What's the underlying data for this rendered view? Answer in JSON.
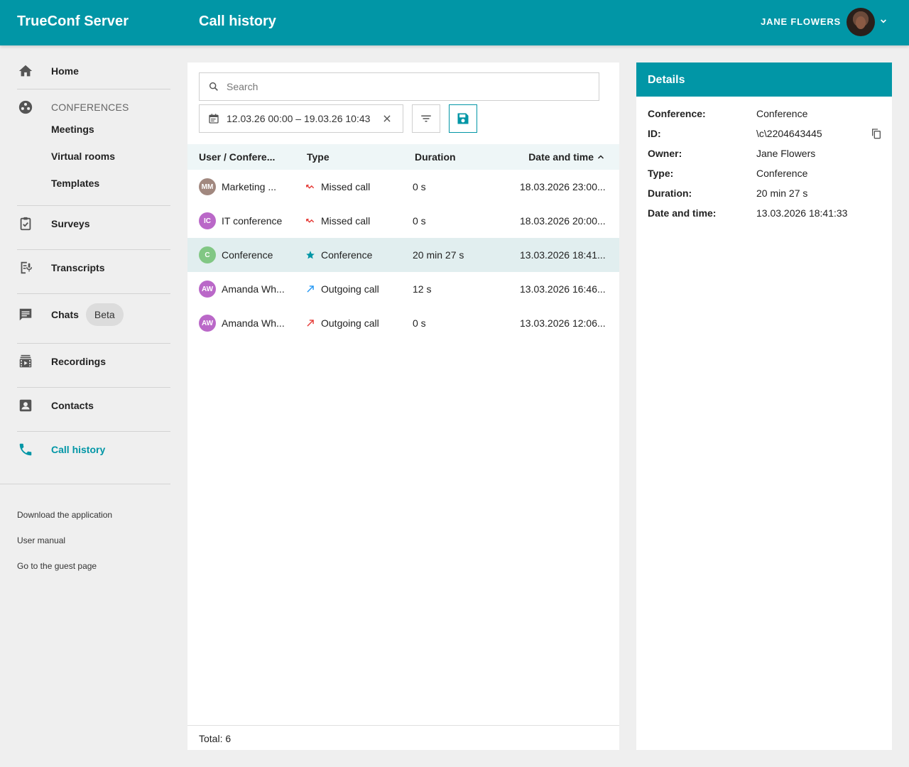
{
  "header": {
    "app_title": "TrueConf Server",
    "page_title": "Call history",
    "user_name": "JANE FLOWERS"
  },
  "sidebar": {
    "home": "Home",
    "conferences_section": "CONFERENCES",
    "meetings": "Meetings",
    "virtual_rooms": "Virtual rooms",
    "templates": "Templates",
    "surveys": "Surveys",
    "transcripts": "Transcripts",
    "chats": "Chats",
    "chats_badge": "Beta",
    "recordings": "Recordings",
    "contacts": "Contacts",
    "call_history": "Call history",
    "footer_links": [
      "Download the application",
      "User manual",
      "Go to the guest page"
    ]
  },
  "toolbar": {
    "search_placeholder": "Search",
    "date_range": "12.03.26 00:00 – 19.03.26 10:43"
  },
  "table": {
    "columns": [
      "User / Confere...",
      "Type",
      "Duration",
      "Date and time"
    ],
    "rows": [
      {
        "initials": "MM",
        "badge_color": "#a1887f",
        "name": "Marketing ...",
        "type": "Missed call",
        "type_icon": "missed-call-icon",
        "duration": "0 s",
        "datetime": "18.03.2026 23:00..."
      },
      {
        "initials": "IC",
        "badge_color": "#ba68c8",
        "name": "IT conference",
        "type": "Missed call",
        "type_icon": "missed-call-icon",
        "duration": "0 s",
        "datetime": "18.03.2026 20:00..."
      },
      {
        "initials": "C",
        "badge_color": "#81c784",
        "name": "Conference",
        "type": "Conference",
        "type_icon": "star-icon",
        "duration": "20 min 27 s",
        "datetime": "13.03.2026 18:41..."
      },
      {
        "initials": "AW",
        "badge_color": "#ba68c8",
        "name": "Amanda Wh...",
        "type": "Outgoing call",
        "type_icon": "outgoing-call-icon",
        "duration": "12 s",
        "datetime": "13.03.2026 16:46..."
      },
      {
        "initials": "AW",
        "badge_color": "#ba68c8",
        "name": "Amanda Wh...",
        "type": "Outgoing call",
        "type_icon": "outgoing-call-icon",
        "duration": "0 s",
        "datetime": "13.03.2026 12:06..."
      }
    ],
    "total": "Total: 6"
  },
  "details": {
    "title": "Details",
    "fields": [
      {
        "label": "Conference:",
        "value": "Conference"
      },
      {
        "label": "ID:",
        "value": "\\c\\2204643445"
      },
      {
        "label": "Owner:",
        "value": "Jane Flowers"
      },
      {
        "label": "Type:",
        "value": "Conference"
      },
      {
        "label": "Duration:",
        "value": "20 min 27 s"
      },
      {
        "label": "Date and time:",
        "value": "13.03.2026 18:41:33"
      }
    ]
  },
  "colors": {
    "accent": "#0196a6",
    "missed": "#e53935",
    "outgoing": "#2196f3",
    "selected_row": "#e1eeef"
  }
}
